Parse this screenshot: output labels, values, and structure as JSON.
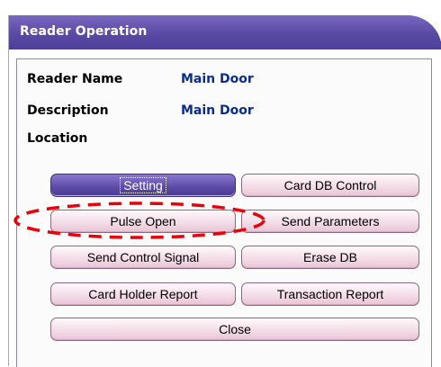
{
  "window": {
    "title": "Reader Operation"
  },
  "info": [
    {
      "label": "Reader Name",
      "value": "Main Door"
    },
    {
      "label": "Description",
      "value": "Main Door"
    },
    {
      "label": "Location",
      "value": ""
    }
  ],
  "buttons": {
    "setting": "Setting",
    "card_db_control": "Card DB Control",
    "pulse_open": "Pulse Open",
    "send_parameters": "Send Parameters",
    "send_control_signal": "Send Control Signal",
    "erase_db": "Erase DB",
    "card_holder_report": "Card Holder Report",
    "transaction_report": "Transaction Report",
    "close": "Close"
  },
  "annotation": {
    "color": "#e8000a",
    "style": "dashed-oval"
  }
}
